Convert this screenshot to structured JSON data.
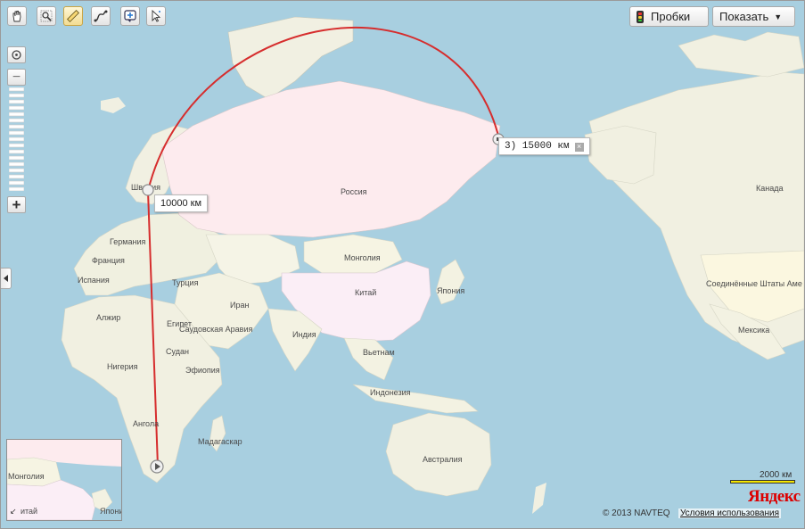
{
  "toolbar": {
    "tools": [
      {
        "name": "hand-tool-icon"
      },
      {
        "name": "magnifier-tool-icon"
      },
      {
        "name": "ruler-tool-icon",
        "active": true
      },
      {
        "name": "route-tool-icon"
      },
      {
        "name": "add-placemark-tool-icon"
      },
      {
        "name": "pointer-tool-icon"
      }
    ],
    "traffic_label": "Пробки",
    "show_label": "Показать",
    "show_arrow": "▼"
  },
  "zoom": {
    "plus": "+",
    "minus": "−"
  },
  "labels": {
    "sweden": "Швеция",
    "germany": "Германия",
    "france": "Франция",
    "spain": "Испания",
    "algeria": "Алжир",
    "turkey": "Турция",
    "egypt": "Египет",
    "saudi": "Саудовская Аравия",
    "iran": "Иран",
    "sudan": "Судан",
    "nigeria": "Нигерия",
    "ethiopia": "Эфиопия",
    "angola": "Ангола",
    "madagascar": "Мадагаскар",
    "russia": "Россия",
    "mongolia": "Монголия",
    "china": "Китай",
    "india": "Индия",
    "japan": "Япония",
    "vietnam": "Вьетнам",
    "indonesia": "Индонезия",
    "australia": "Австралия",
    "canada": "Канада",
    "usa": "Соединённые Штаты Аме",
    "mexico": "Мексика"
  },
  "ruler": {
    "point2_label": "10000 км",
    "point3_label": "3) 15000 км",
    "close": "×",
    "start_icon": "ruler-start-icon"
  },
  "minimap": {
    "mongolia": "Монголия",
    "china_partial": "итай",
    "japan_partial": "Япони",
    "arrow": "↙"
  },
  "scale": {
    "label": "2000 км",
    "color": "#f5e600"
  },
  "logo": {
    "text": "Яндекс"
  },
  "footer": {
    "copyright": "© 2013 NAVTEQ",
    "terms_link": "Условия использования"
  },
  "colors": {
    "water": "#a8cfe0",
    "land": "#f4f2e4",
    "russia": "#fdebee",
    "china": "#fbeef6",
    "route": "#d62d2d"
  }
}
